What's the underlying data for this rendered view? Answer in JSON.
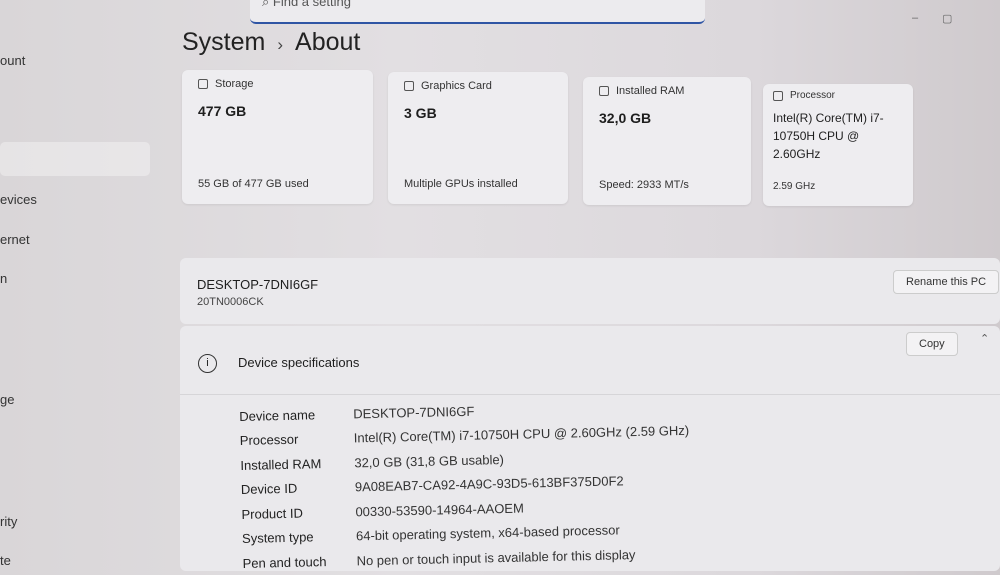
{
  "search": {
    "placeholder": "Find a setting"
  },
  "sidebar": {
    "items": [
      "ount",
      "evices",
      "ernet",
      "n",
      "ge",
      "rity",
      "te"
    ]
  },
  "header": {
    "parent": "System",
    "separator": "›",
    "title": "About"
  },
  "cards": [
    {
      "label": "Storage",
      "value": "477 GB",
      "footer": "55 GB of 477 GB used"
    },
    {
      "label": "Graphics Card",
      "value": "3 GB",
      "footer": "Multiple GPUs installed"
    },
    {
      "label": "Installed RAM",
      "value": "32,0 GB",
      "footer": "Speed: 2933 MT/s"
    },
    {
      "label": "Processor",
      "value": "Intel(R) Core(TM) i7-10750H CPU @ 2.60GHz",
      "footer": "2.59 GHz"
    }
  ],
  "device": {
    "name": "DESKTOP-7DNI6GF",
    "model": "20TN0006CK",
    "rename_label": "Rename this PC"
  },
  "specs": {
    "title": "Device specifications",
    "copy_label": "Copy",
    "rows": [
      {
        "k": "Device name",
        "v": "DESKTOP-7DNI6GF"
      },
      {
        "k": "Processor",
        "v": "Intel(R) Core(TM) i7-10750H CPU @ 2.60GHz (2.59 GHz)"
      },
      {
        "k": "Installed RAM",
        "v": "32,0 GB (31,8 GB usable)"
      },
      {
        "k": "Device ID",
        "v": "9A08EAB7-CA92-4A9C-93D5-613BF375D0F2"
      },
      {
        "k": "Product ID",
        "v": "00330-53590-14964-AAOEM"
      },
      {
        "k": "System type",
        "v": "64-bit operating system, x64-based processor"
      },
      {
        "k": "Pen and touch",
        "v": "No pen or touch input is available for this display"
      }
    ]
  }
}
